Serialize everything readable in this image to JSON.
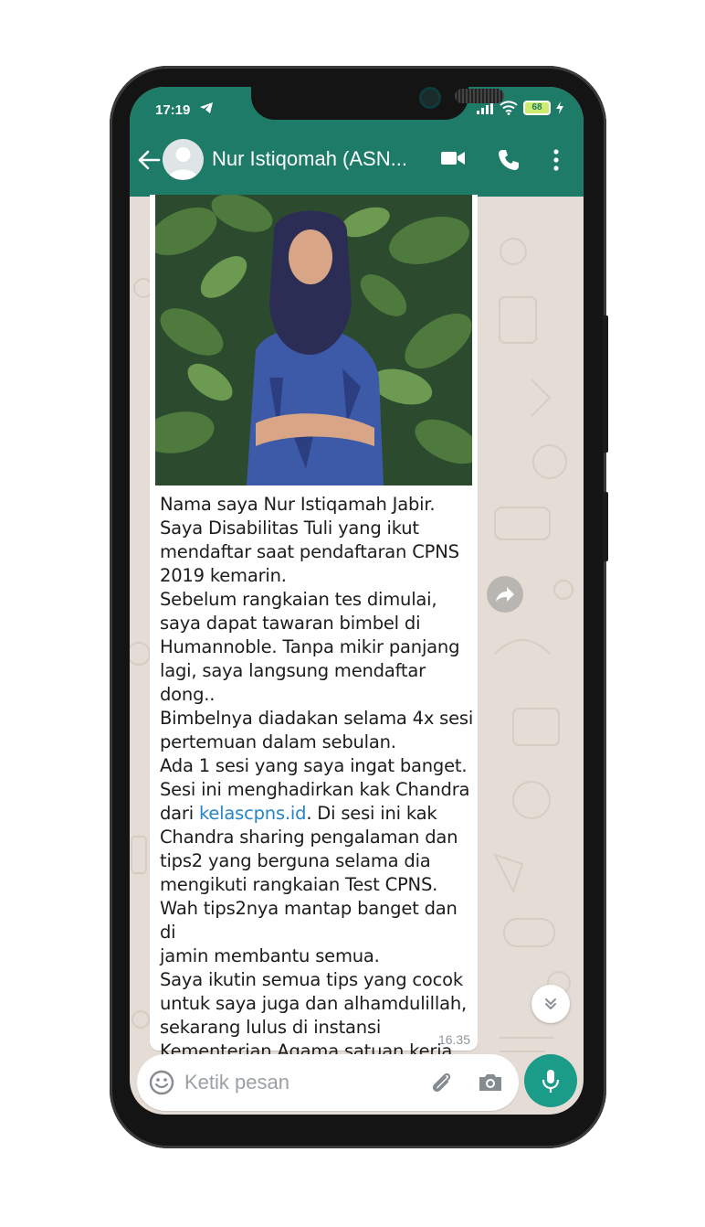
{
  "status_bar": {
    "time": "17:19",
    "battery": "68"
  },
  "header": {
    "contact_name": "Nur Istiqomah (ASN..."
  },
  "message": {
    "paragraph_1": "Nama saya Nur Istiqamah Jabir.\nSaya Disabilitas Tuli yang ikut\nmendaftar saat pendaftaran CPNS\n2019 kemarin.\nSebelum rangkaian tes dimulai,\nsaya dapat tawaran bimbel di\nHumannoble. Tanpa mikir panjang\nlagi, saya langsung mendaftar dong..\nBimbelnya diadakan selama 4x sesi\npertemuan dalam sebulan.\nAda 1 sesi yang saya ingat banget.\nSesi ini menghadirkan kak Chandra\ndari ",
    "link": "kelascpns.id",
    "paragraph_2": ". Di sesi ini kak\nChandra sharing pengalaman dan\ntips2 yang berguna selama dia\nmengikuti rangkaian Test CPNS.\nWah tips2nya mantap banget dan di\njamin membantu semua.\nSaya ikutin semua tips yang cocok\nuntuk saya juga dan alhamdulillah,\nsekarang lulus di instansi\nKementerian Agama satuan kerja\nIAIN Parepare",
    "time": "16.35"
  },
  "composer": {
    "placeholder": "Ketik pesan"
  },
  "colors": {
    "header": "#1d7b67",
    "chat_background": "#e5ddd5",
    "link": "#2585c8",
    "mic_button": "#1b9c88"
  }
}
